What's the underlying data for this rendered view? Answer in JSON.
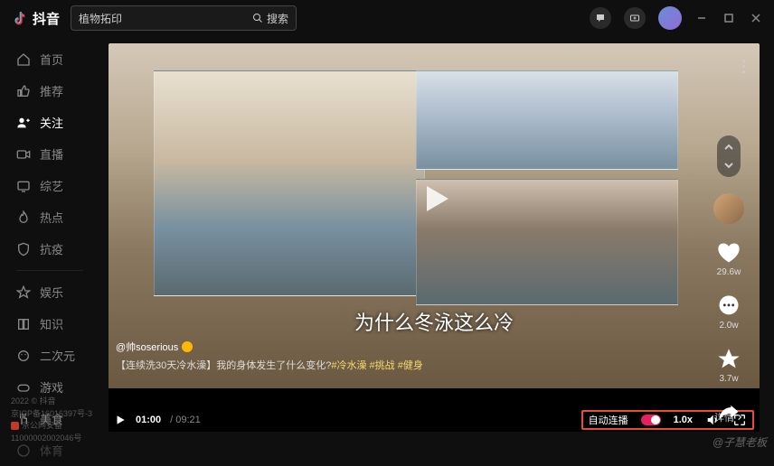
{
  "app": {
    "name": "抖音"
  },
  "search": {
    "value": "植物拓印",
    "button": "搜索"
  },
  "sidebar": {
    "items": [
      {
        "label": "首页"
      },
      {
        "label": "推荐"
      },
      {
        "label": "关注"
      },
      {
        "label": "直播"
      },
      {
        "label": "综艺"
      },
      {
        "label": "热点"
      },
      {
        "label": "抗疫"
      },
      {
        "label": "娱乐"
      },
      {
        "label": "知识"
      },
      {
        "label": "二次元"
      },
      {
        "label": "游戏"
      },
      {
        "label": "美食"
      },
      {
        "label": "体育"
      }
    ]
  },
  "footer": {
    "line1": "2022 © 抖音",
    "line2": "京ICP备16016397号-3",
    "line3": "京公网安备",
    "line4": "11000002002046号"
  },
  "video": {
    "user": "@帅soserious",
    "title": "【连续洗30天冷水澡】我的身体发生了什么变化?",
    "tags": "#冷水澡 #挑战 #健身",
    "caption": "为什么冬泳这么冷",
    "current_time": "01:00",
    "duration": "09:21",
    "autoplay_label": "自动连播",
    "speed": "1.0x",
    "details": "详情"
  },
  "actions": {
    "like": "29.6w",
    "comment": "2.0w",
    "favorite": "3.7w"
  },
  "watermark": "@子慧老板"
}
